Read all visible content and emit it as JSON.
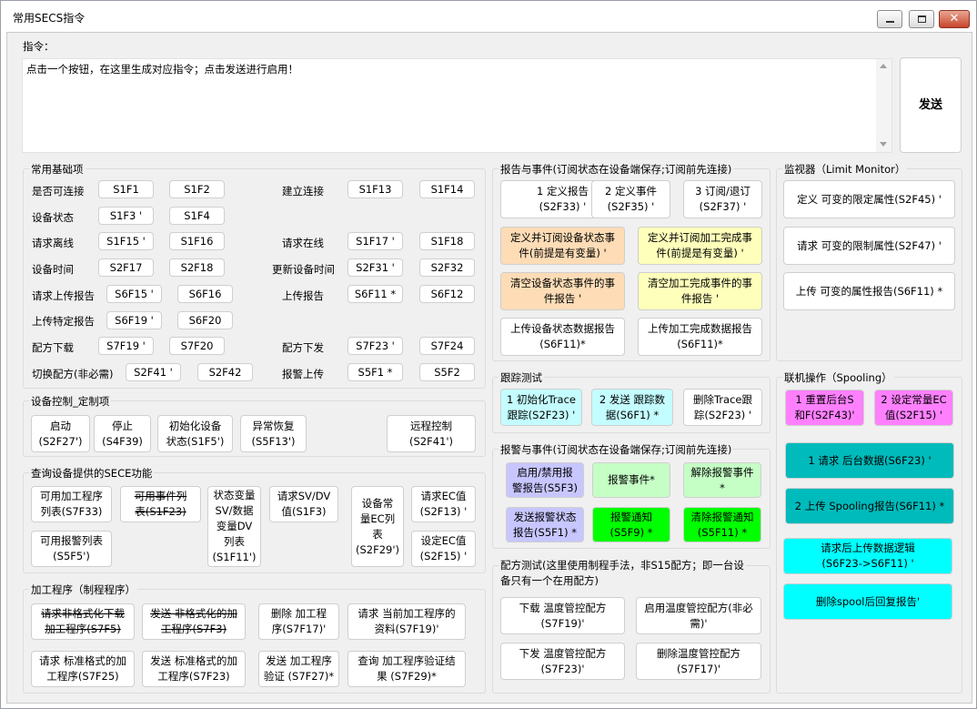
{
  "window": {
    "title": "常用SECS指令"
  },
  "command": {
    "label": "指令：",
    "text": "点击一个按钮，在这里生成对应指令；点击发送进行启用！",
    "send": "发送"
  },
  "basic": {
    "title": "常用基础项",
    "labels": [
      "是否可连接",
      "设备状态",
      "请求离线",
      "设备时间",
      "请求上传报告",
      "上传特定报告",
      "配方下载",
      "切换配方(非必需)",
      "建立连接",
      "请求在线",
      "更新设备时间",
      "上传报告",
      "配方下发",
      "报警上传"
    ],
    "buttons": [
      "S1F1",
      "S1F2",
      "S1F3 '",
      "S1F4",
      "S1F15 '",
      "S1F16",
      "S2F17",
      "S2F18",
      "S6F15 '",
      "S6F16",
      "S6F19 '",
      "S6F20",
      "S7F19 '",
      "S7F20",
      "S2F41 '",
      "S2F42",
      "S1F13",
      "S1F14",
      "S1F17 '",
      "S1F18",
      "S2F31 '",
      "S2F32",
      "S6F11 *",
      "S6F12",
      "S7F23 '",
      "S7F24",
      "S5F1 *",
      "S5F2"
    ]
  },
  "control": {
    "title": "设备控制_定制项",
    "buttons": [
      "启动\n(S2F27')",
      "停止\n(S4F39)",
      "初始化设备\n状态(S1F5')",
      "异常恢复\n(S5F13')",
      "远程控制\n(S2F41')"
    ]
  },
  "secefunc": {
    "title": "查询设备提供的SECE功能",
    "buttons": [
      "可用加工程序\n列表(S7F33)",
      "可用事件列\n表(S1F23)",
      "状态变量\nSV/数据\n变量DV\n列表\n(S1F11')",
      "请求SV/DV\n值(S1F3)",
      "设备常\n量EC列\n表\n(S2F29')",
      "请求EC值\n(S2F13) '",
      "可用报警列表\n(S5F5')",
      "设定EC值\n(S2F15) '"
    ]
  },
  "recipe": {
    "title": "加工程序（制程程序）",
    "buttons": [
      "请求非格式化下载\n加工程序(S7F5)",
      "发送 非格式化的加\n工程序(S7F3)",
      "删除 加工程\n序(S7F17)'",
      "请求 当前加工程序的\n资料(S7F19)'",
      "请求 标准格式的加\n工程序(S7F25)",
      "发送 标准格式的加\n工程序(S7F23)",
      "发送 加工程序\n验证 (S7F27)*",
      "查询 加工程序验证结\n果 (S7F29)*"
    ]
  },
  "report": {
    "title": "报告与事件(订阅状态在设备端保存;订阅前先连接)",
    "buttons": [
      "1 定义报告\n(S2F33) '",
      "2 定义事件\n(S2F35) '",
      "3 订阅/退订\n(S2F37) '",
      "定义并订阅设备状态事\n件(前提是有变量) '",
      "定义并订阅加工完成事\n件(前提是有变量) '",
      "清空设备状态事件的事\n件报告 '",
      "清空加工完成事件的事\n件报告 '",
      "上传设备状态数据报告\n(S6F11)*",
      "上传加工完成数据报告\n(S6F11)*"
    ]
  },
  "trace": {
    "title": "跟踪测试",
    "buttons": [
      "1 初始化Trace\n跟踪(S2F23) '",
      "2 发送 跟踪数\n据(S6F1) *",
      "删除Trace跟\n踪(S2F23) '"
    ]
  },
  "alarm": {
    "title": "报警与事件(订阅状态在设备端保存;订阅前先连接)",
    "buttons": [
      "启用/禁用报\n警报告(S5F3)",
      "报警事件*",
      "解除报警事件\n*",
      "发送报警状态\n报告(S5F1) *",
      "报警通知\n(S5F9) *",
      "清除报警通知\n(S5F11) *"
    ]
  },
  "recipetest": {
    "title": "配方测试(这里使用制程手法，非S15配方；即一台设\n备只有一个在用配方)",
    "buttons": [
      "下载 温度管控配方\n(S7F19)'",
      "启用温度管控配方(非必\n需)'",
      "下发 温度管控配方\n(S7F23)'",
      "删除温度管控配方\n(S7F17)'"
    ]
  },
  "monitor": {
    "title": "监视器（Limit Monitor）",
    "buttons": [
      "定义 可变的限定属性(S2F45) '",
      "请求 可变的限制属性(S2F47) '",
      "上传 可变的属性报告(S6F11) *"
    ]
  },
  "spooling": {
    "title": "联机操作（Spooling）",
    "buttons": [
      "1 重置后台S\n和F(S2F43)'",
      "2 设定常量EC\n值(S2F15) '",
      "1 请求 后台数据(S6F23) '",
      "2 上传 Spooling报告(S6F11) *",
      "请求后上传数据逻辑\n(S6F23->S6F11) '",
      "删除spool后回复报告'"
    ]
  },
  "colors": {
    "orange": "#fddcb6",
    "yellow": "#feffba",
    "cyan": "#c4fdff",
    "lavender": "#c7c6ff",
    "lightgreen": "#c5ffc5",
    "green": "#00ff00",
    "magenta": "#ff80ff",
    "teal": "#00bbbb",
    "aqua": "#00ffff"
  }
}
